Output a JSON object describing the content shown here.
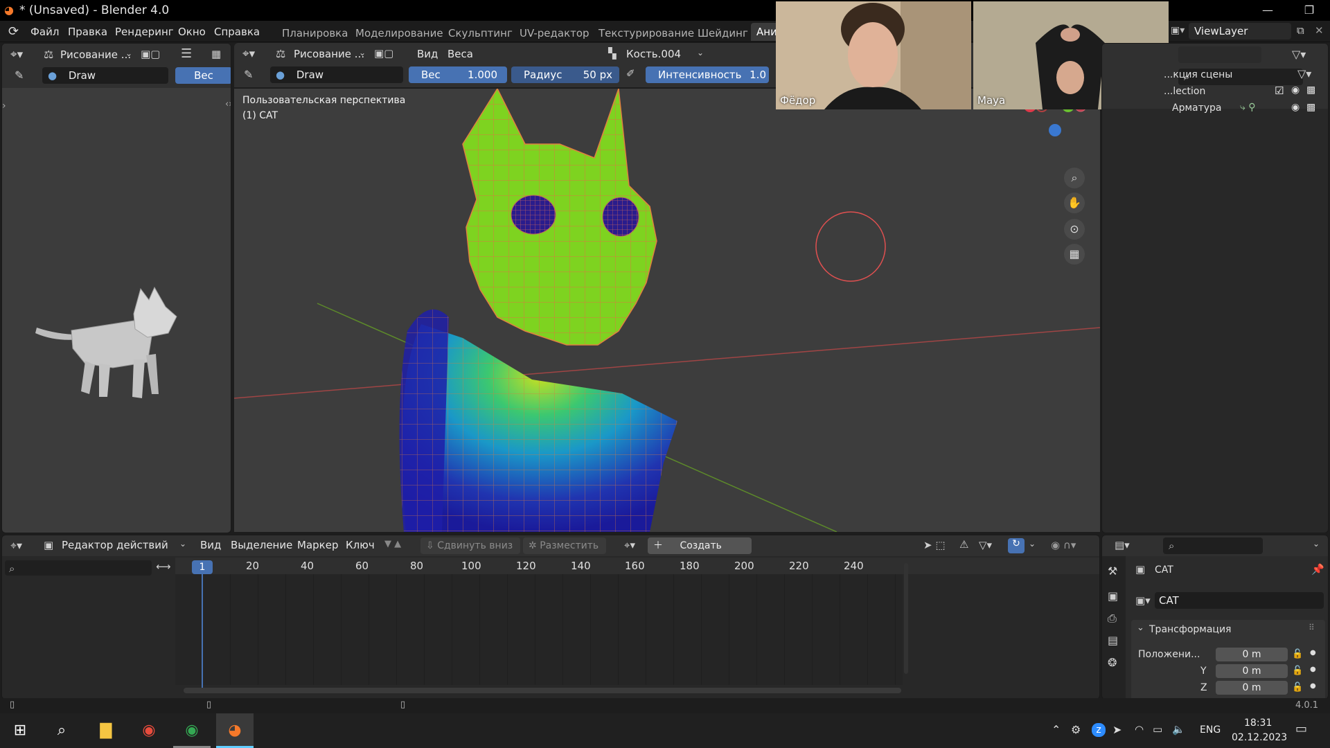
{
  "window": {
    "title": "* (Unsaved) - Blender 4.0"
  },
  "menu": {
    "items": [
      "Файл",
      "Правка",
      "Рендеринг",
      "Окно",
      "Справка"
    ]
  },
  "workspaces": {
    "tabs": [
      "Планировка",
      "Моделирование",
      "Скульптинг",
      "UV-редактор",
      "Текстурирование",
      "Шейдинг",
      "Ани"
    ],
    "active": "Ани"
  },
  "left_panel": {
    "mode_label": "Рисование ...",
    "brush_name": "Draw",
    "weight_label": "Вес"
  },
  "viewport_header": {
    "mode_label": "Рисование ...",
    "view_menu": "Вид",
    "weights_menu": "Веса",
    "bone_name": "Кость.004",
    "brush_name": "Draw",
    "weight_label": "Вес",
    "weight_value": "1.000",
    "radius_label": "Радиус",
    "radius_value": "50 px",
    "strength_label": "Интенсивность",
    "strength_value": "1.0"
  },
  "viewport": {
    "view_name": "Пользовательская перспектива",
    "object_label": "(1) CAT",
    "gizmo": {
      "x": "X",
      "y": "Y"
    }
  },
  "video_call": {
    "participants": [
      "Фёдор",
      "Maya"
    ]
  },
  "outliner": {
    "view_layer": "ViewLayer",
    "scene_collection": "...кция сцены",
    "collection": "...lection",
    "armature": "Арматура"
  },
  "dopesheet": {
    "editor_label": "Редактор действий",
    "menus": [
      "Вид",
      "Выделение",
      "Маркер",
      "Ключ"
    ],
    "push_down": "Сдвинуть вниз",
    "stash": "Разместить",
    "new_label": "Создать",
    "current_frame": "1",
    "frame_marks": [
      "20",
      "40",
      "60",
      "80",
      "100",
      "120",
      "140",
      "160",
      "180",
      "200",
      "220",
      "240"
    ]
  },
  "properties": {
    "object_name": "CAT",
    "object_field": "CAT",
    "transform_label": "Трансформация",
    "location_label": "Положени...",
    "y_label": "Y",
    "z_label": "Z",
    "loc_x": "0 m",
    "loc_y": "0 m",
    "loc_z": "0 m"
  },
  "status_bar": {
    "version": "4.0.1"
  },
  "taskbar": {
    "lang": "ENG",
    "time": "18:31",
    "date": "02.12.2023"
  },
  "colors": {
    "accent_blue": "#4772b3",
    "weight_green": "#7ed320",
    "weight_blue": "#1f1fa8"
  }
}
